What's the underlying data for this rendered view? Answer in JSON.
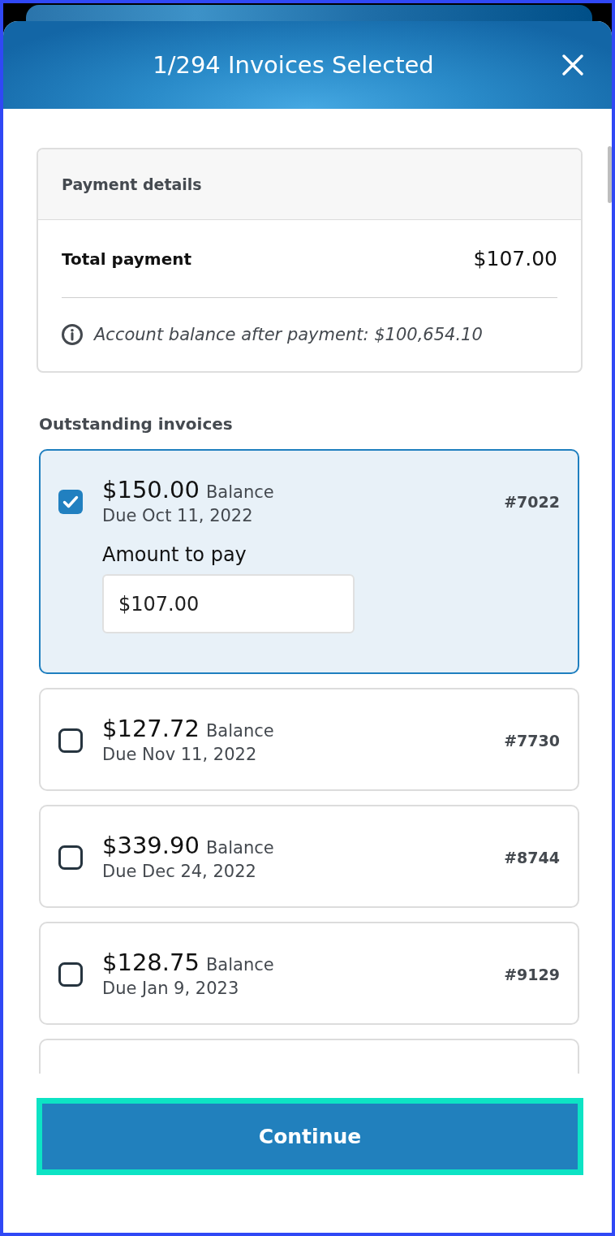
{
  "sheet": {
    "title": "1/294 Invoices Selected"
  },
  "payment_details": {
    "heading": "Payment details",
    "total_label": "Total payment",
    "total_value": "$107.00",
    "note": "Account balance after payment: $100,654.10"
  },
  "outstanding": {
    "heading": "Outstanding invoices",
    "invoices": [
      {
        "amount": "$150.00",
        "balance_label": "Balance",
        "due": "Due Oct 11, 2022",
        "number": "#7022",
        "selected": true,
        "amount_to_pay": {
          "label": "Amount to pay",
          "value": "$107.00"
        }
      },
      {
        "amount": "$127.72",
        "balance_label": "Balance",
        "due": "Due Nov 11, 2022",
        "number": "#7730",
        "selected": false
      },
      {
        "amount": "$339.90",
        "balance_label": "Balance",
        "due": "Due Dec 24, 2022",
        "number": "#8744",
        "selected": false
      },
      {
        "amount": "$128.75",
        "balance_label": "Balance",
        "due": "Due Jan 9, 2023",
        "number": "#9129",
        "selected": false
      }
    ]
  },
  "continue_button": {
    "label": "Continue",
    "highlighted": true
  }
}
